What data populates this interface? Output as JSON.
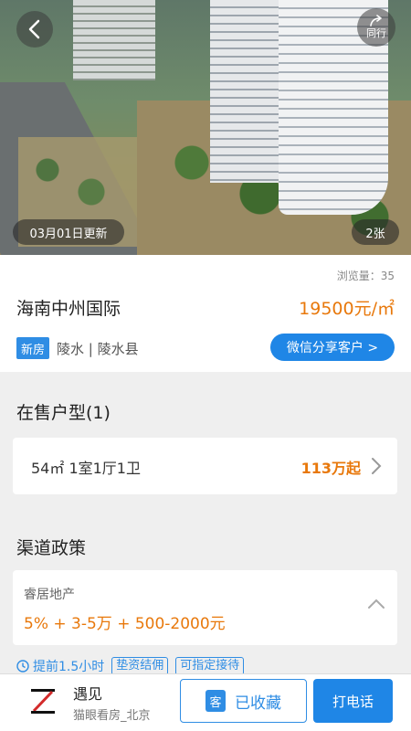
{
  "hero": {
    "share_label": "同行",
    "update_text": "03月01日更新",
    "photo_count": "2张"
  },
  "info": {
    "views_text": "浏览量：35",
    "title": "海南中州国际",
    "price": "19500元/㎡",
    "tag": "新房",
    "location": "陵水 | 陵水县",
    "wechat_button": "微信分享客户 >"
  },
  "units": {
    "section_title": "在售户型(1)",
    "items": [
      {
        "desc": "54㎡  1室1厅1卫",
        "price": "113万起"
      }
    ]
  },
  "policy": {
    "section_title": "渠道政策",
    "agency": "睿居地产",
    "terms": "5% + 3-5万 + 500-2000元",
    "tags": [
      "提前1.5小时",
      "垫资结佣",
      "可指定接待"
    ]
  },
  "bottom_bar": {
    "brand_name": "遇见",
    "brand_sub": "猫眼看房_北京",
    "fav_badge": "客",
    "fav_label": "已收藏",
    "call_label": "打电话"
  },
  "colors": {
    "accent_blue": "#1f86e6",
    "price_orange": "#e8780b"
  }
}
